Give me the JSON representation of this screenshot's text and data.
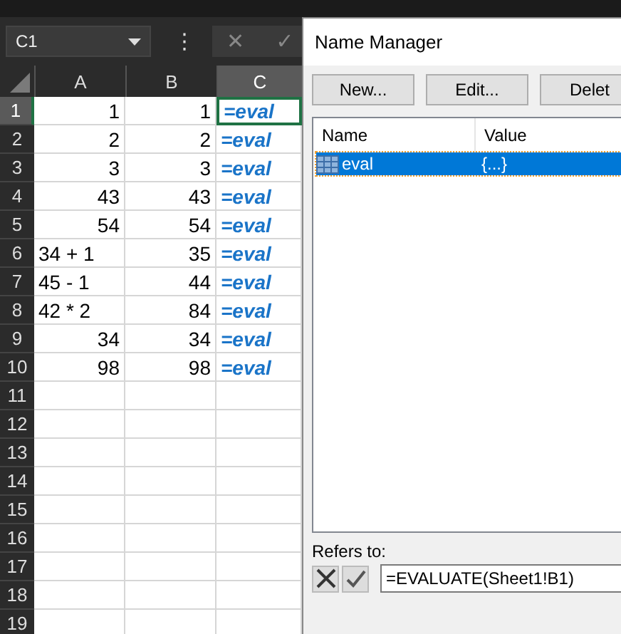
{
  "name_box": {
    "value": "C1"
  },
  "formula_buttons": [
    {
      "kind": "more",
      "label": "⋮"
    },
    {
      "kind": "cancel",
      "label": "✕"
    },
    {
      "kind": "enter",
      "label": "✓"
    }
  ],
  "columns": [
    {
      "label": "A",
      "selected": false
    },
    {
      "label": "B",
      "selected": false
    },
    {
      "label": "C",
      "selected": true
    }
  ],
  "rows": [
    {
      "header": "1",
      "selected": true,
      "cells": [
        {
          "text": "1",
          "kind": "number"
        },
        {
          "text": "1",
          "kind": "number"
        },
        {
          "text": "=eval",
          "kind": "formula",
          "selected": true
        }
      ]
    },
    {
      "header": "2",
      "selected": false,
      "cells": [
        {
          "text": "2",
          "kind": "number"
        },
        {
          "text": "2",
          "kind": "number"
        },
        {
          "text": "=eval",
          "kind": "formula",
          "selected": false
        }
      ]
    },
    {
      "header": "3",
      "selected": false,
      "cells": [
        {
          "text": "3",
          "kind": "number"
        },
        {
          "text": "3",
          "kind": "number"
        },
        {
          "text": "=eval",
          "kind": "formula",
          "selected": false
        }
      ]
    },
    {
      "header": "4",
      "selected": false,
      "cells": [
        {
          "text": "43",
          "kind": "number"
        },
        {
          "text": "43",
          "kind": "number"
        },
        {
          "text": "=eval",
          "kind": "formula",
          "selected": false
        }
      ]
    },
    {
      "header": "5",
      "selected": false,
      "cells": [
        {
          "text": "54",
          "kind": "number"
        },
        {
          "text": "54",
          "kind": "number"
        },
        {
          "text": "=eval",
          "kind": "formula",
          "selected": false
        }
      ]
    },
    {
      "header": "6",
      "selected": false,
      "cells": [
        {
          "text": "34 + 1",
          "kind": "text"
        },
        {
          "text": "35",
          "kind": "number"
        },
        {
          "text": "=eval",
          "kind": "formula",
          "selected": false
        }
      ]
    },
    {
      "header": "7",
      "selected": false,
      "cells": [
        {
          "text": "45 - 1",
          "kind": "text"
        },
        {
          "text": "44",
          "kind": "number"
        },
        {
          "text": "=eval",
          "kind": "formula",
          "selected": false
        }
      ]
    },
    {
      "header": "8",
      "selected": false,
      "cells": [
        {
          "text": "42 * 2",
          "kind": "text"
        },
        {
          "text": "84",
          "kind": "number"
        },
        {
          "text": "=eval",
          "kind": "formula",
          "selected": false
        }
      ]
    },
    {
      "header": "9",
      "selected": false,
      "cells": [
        {
          "text": "34",
          "kind": "number"
        },
        {
          "text": "34",
          "kind": "number"
        },
        {
          "text": "=eval",
          "kind": "formula",
          "selected": false
        }
      ]
    },
    {
      "header": "10",
      "selected": false,
      "cells": [
        {
          "text": "98",
          "kind": "number"
        },
        {
          "text": "98",
          "kind": "number"
        },
        {
          "text": "=eval",
          "kind": "formula",
          "selected": false
        }
      ]
    },
    {
      "header": "11",
      "selected": false,
      "cells": []
    },
    {
      "header": "12",
      "selected": false,
      "cells": []
    },
    {
      "header": "13",
      "selected": false,
      "cells": []
    },
    {
      "header": "14",
      "selected": false,
      "cells": []
    },
    {
      "header": "15",
      "selected": false,
      "cells": []
    },
    {
      "header": "16",
      "selected": false,
      "cells": []
    },
    {
      "header": "17",
      "selected": false,
      "cells": []
    },
    {
      "header": "18",
      "selected": false,
      "cells": []
    },
    {
      "header": "19",
      "selected": false,
      "cells": []
    }
  ],
  "dialog": {
    "title": "Name Manager",
    "buttons": [
      "New...",
      "Edit...",
      "Delet"
    ],
    "list_columns": [
      "Name",
      "Value"
    ],
    "names": [
      {
        "name": "eval",
        "value": "{...}",
        "selected": true
      }
    ],
    "refers_to": {
      "label": "Refers to:",
      "value": "=EVALUATE(Sheet1!B1)"
    }
  }
}
